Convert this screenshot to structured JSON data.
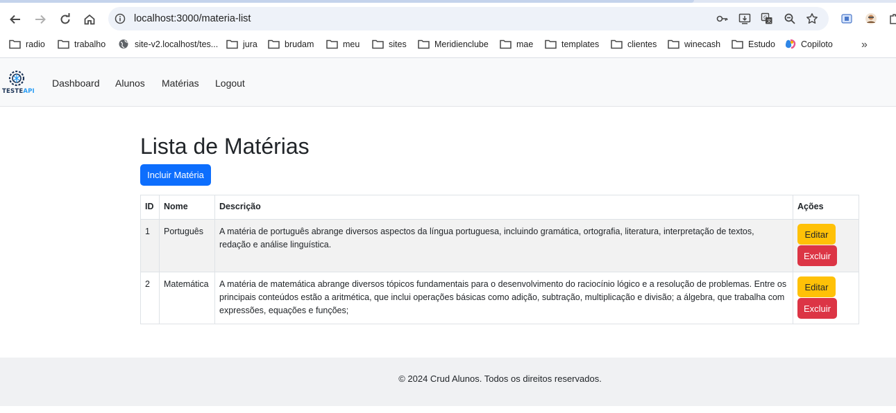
{
  "browser": {
    "url": "localhost:3000/materia-list",
    "bookmarks": [
      "radio",
      "trabalho",
      "site-v2.localhost/tes...",
      "jura",
      "brudam",
      "meu",
      "sites",
      "Meridienclube",
      "mae",
      "templates",
      "clientes",
      "winecash",
      "Estudo",
      "Copiloto"
    ],
    "more_label": "»"
  },
  "navbar": {
    "brand_main": "TESTE",
    "brand_accent": "API",
    "links": [
      "Dashboard",
      "Alunos",
      "Matérias",
      "Logout"
    ]
  },
  "main": {
    "title": "Lista de Matérias",
    "add_button": "Incluir Matéria",
    "table": {
      "headers": [
        "ID",
        "Nome",
        "Descrição",
        "Ações"
      ],
      "rows": [
        {
          "id": "1",
          "nome": "Português",
          "descricao": "A matéria de português abrange diversos aspectos da língua portuguesa, incluindo gramática, ortografia, literatura, interpretação de textos, redação e análise linguística.",
          "edit": "Editar",
          "delete": "Excluir"
        },
        {
          "id": "2",
          "nome": "Matemática",
          "descricao": "A matéria de matemática abrange diversos tópicos fundamentais para o desenvolvimento do raciocínio lógico e a resolução de problemas. Entre os principais conteúdos estão a aritmética, que inclui operações básicas como adição, subtração, multiplicação e divisão; a álgebra, que trabalha com expressões, equações e funções;",
          "edit": "Editar",
          "delete": "Excluir"
        }
      ]
    }
  },
  "footer": {
    "text": "© 2024 Crud Alunos. Todos os direitos reservados."
  },
  "colors": {
    "primary": "#0d6efd",
    "warning": "#ffc107",
    "danger": "#dc3545",
    "navbar_bg": "#f8f9fa"
  }
}
